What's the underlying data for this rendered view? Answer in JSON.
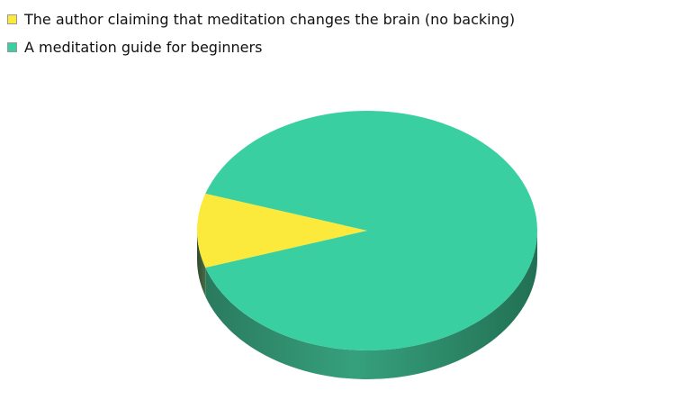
{
  "chart_data": {
    "type": "pie",
    "style": "3d",
    "legend_position": "top-left",
    "slices": [
      {
        "label": "The author claiming that meditation changes the brain (no backing)",
        "value": 10,
        "color": "#fbe93b",
        "side_color": "#3e5e3e"
      },
      {
        "label": "A meditation guide for beginners",
        "value": 90,
        "color": "#3acfa1",
        "side_color": "#2b8b6b"
      }
    ]
  }
}
